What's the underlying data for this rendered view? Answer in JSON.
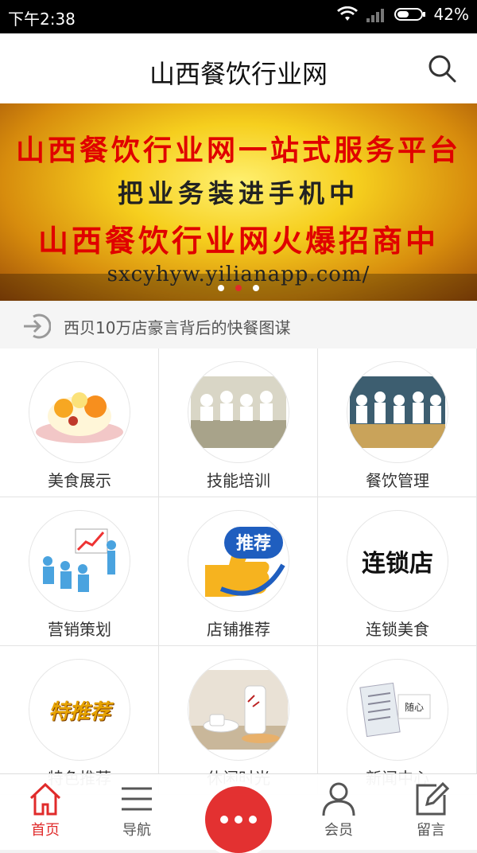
{
  "status_bar": {
    "time": "下午2:38",
    "battery": "42%"
  },
  "header": {
    "title": "山西餐饮行业网"
  },
  "banner": {
    "line1": "山西餐饮行业网一站式服务平台",
    "line2": "把业务装进手机中",
    "line3": "山西餐饮行业网火爆招商中",
    "url": "sxcyhyw.yilianapp.com/",
    "slides": 3,
    "active_slide": 2
  },
  "news": {
    "text": "西贝10万店豪言背后的快餐图谋"
  },
  "grid": [
    {
      "label": "美食展示",
      "icon": "food-dessert-image"
    },
    {
      "label": "技能培训",
      "icon": "chefs-training-image"
    },
    {
      "label": "餐饮管理",
      "icon": "chefs-team-image"
    },
    {
      "label": "营销策划",
      "icon": "presentation-image"
    },
    {
      "label": "店铺推荐",
      "icon": "thumbs-up-recommend-image",
      "badge": "推荐"
    },
    {
      "label": "连锁美食",
      "icon": "chain-store-text-image",
      "badge": "连锁店"
    },
    {
      "label": "特色推荐",
      "icon": "special-recommend-text-image",
      "badge": "特推荐"
    },
    {
      "label": "休闲时光",
      "icon": "tea-set-image"
    },
    {
      "label": "新闻中心",
      "icon": "newspaper-image",
      "badge": "随心"
    }
  ],
  "tabbar": {
    "home": "首页",
    "nav": "导航",
    "member": "会员",
    "message": "留言"
  },
  "colors": {
    "accent": "#e33131",
    "banner_text": "#e00000"
  }
}
